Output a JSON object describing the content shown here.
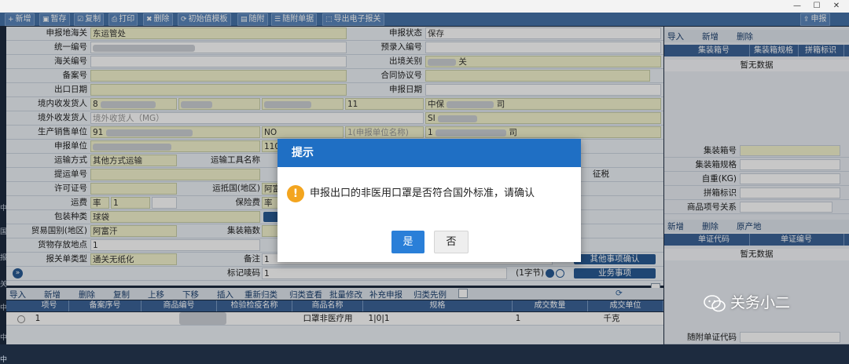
{
  "window": {
    "minimize": "—",
    "maximize": "☐",
    "close": "✕"
  },
  "toolbar": {
    "buttons": [
      {
        "icon": "+",
        "label": "新增"
      },
      {
        "icon": "▣",
        "label": "暂存"
      },
      {
        "icon": "☑",
        "label": "复制"
      },
      {
        "icon": "⎙",
        "label": "打印"
      },
      {
        "icon": "✖",
        "label": "删除"
      },
      {
        "icon": "⟳",
        "label": "初始值模板"
      },
      {
        "icon": "▤",
        "label": "随附"
      },
      {
        "icon": "☰",
        "label": "随附单据"
      },
      {
        "icon": "⬚",
        "label": "导出电子报关"
      }
    ],
    "submit": {
      "icon": "⇪",
      "label": "申报"
    }
  },
  "left_strip": [
    "中",
    "国",
    "报",
    "关",
    "中",
    "中",
    "中"
  ],
  "form": {
    "r1": {
      "l1": "申报地海关",
      "v1": "东运管处",
      "l2": "申报状态",
      "v2": "保存"
    },
    "r2": {
      "l1": "统一编号",
      "l2": "预录入编号"
    },
    "r3": {
      "l1": "海关编号",
      "l2": "出境关别",
      "v2": "关"
    },
    "r4": {
      "l1": "备案号",
      "l2": "合同协议号"
    },
    "r5": {
      "l1": "出口日期",
      "l2": "申报日期"
    },
    "r6": {
      "l1": "境内收发货人",
      "v1": "8",
      "v2": "11",
      "v3": "中保",
      "v4": "司"
    },
    "r7": {
      "l1": "境外收发货人",
      "v1": "境外收货人（MG）",
      "v2": "SI"
    },
    "r8": {
      "l1": "生产销售单位",
      "v1": "91",
      "v2": "NO",
      "v3": "1(申报单位名称)",
      "v4": "1",
      "v5": "司"
    },
    "r9": {
      "l1": "申报单位",
      "v2": "110"
    },
    "r10": {
      "l1": "运输方式",
      "v1": "其他方式运输",
      "l2": "运输工具名称"
    },
    "r11": {
      "l1": "提运单号",
      "v4": "征税"
    },
    "r12": {
      "l1": "许可证号",
      "l2": "运抵国(地区)",
      "v2": "阿富"
    },
    "r13": {
      "l1": "运费",
      "v1": "率",
      "v2": "1",
      "l2": "保险费",
      "v3": "率"
    },
    "r14": {
      "l1": "包装种类",
      "v1": "球袋"
    },
    "r15": {
      "l1": "贸易国别(地区)",
      "v1": "阿富汗",
      "l2": "集装箱数"
    },
    "r16": {
      "l1": "货物存放地点",
      "v1": "1"
    },
    "r17": {
      "l1": "报关单类型",
      "v1": "通关无纸化",
      "l2": "备注",
      "v2": "1",
      "btn": "其他事项确认"
    },
    "r18": {
      "l2": "标记唛码",
      "v2": "1",
      "count": "(1字节)",
      "btn": "业务事项"
    }
  },
  "right_panel": {
    "toolbar": [
      "导入",
      "新增",
      "删除"
    ],
    "headers": [
      "集装箱号",
      "集装箱规格",
      "拼箱标识"
    ],
    "empty": "暂无数据",
    "fields": [
      "集装箱号",
      "集装箱规格",
      "自重(KG)",
      "拼箱标识",
      "商品项号关系"
    ],
    "toolbar2": [
      "新增",
      "删除",
      "原产地"
    ],
    "headers2": [
      "单证代码",
      "单证编号"
    ],
    "empty2": "暂无数据",
    "footer_label": "随附单证代码"
  },
  "goods_grid": {
    "toolbar": [
      "导入",
      "新增",
      "删除",
      "复制",
      "上移",
      "下移",
      "插入",
      "重新归类",
      "归类查看",
      "批量修改",
      "补充申报",
      "归类先例"
    ],
    "headers": [
      "项号",
      "备案序号",
      "商品编号",
      "检验检疫名称",
      "商品名称",
      "规格",
      "成交数量",
      "成交单位"
    ],
    "row": {
      "no": "1",
      "name": "口罩非医疗用",
      "spec": "1|0|1",
      "qty": "1",
      "unit": "千克"
    }
  },
  "dialog": {
    "title": "提示",
    "message": "申报出口的非医用口罩是否符合国外标准，请确认",
    "yes": "是",
    "no": "否"
  },
  "watermark": {
    "text": "关务小二"
  },
  "colors": {
    "accent": "#1f6fc4",
    "toolbar": "#4673a8",
    "field": "#f4f4cf",
    "warning": "#f3a51f"
  }
}
